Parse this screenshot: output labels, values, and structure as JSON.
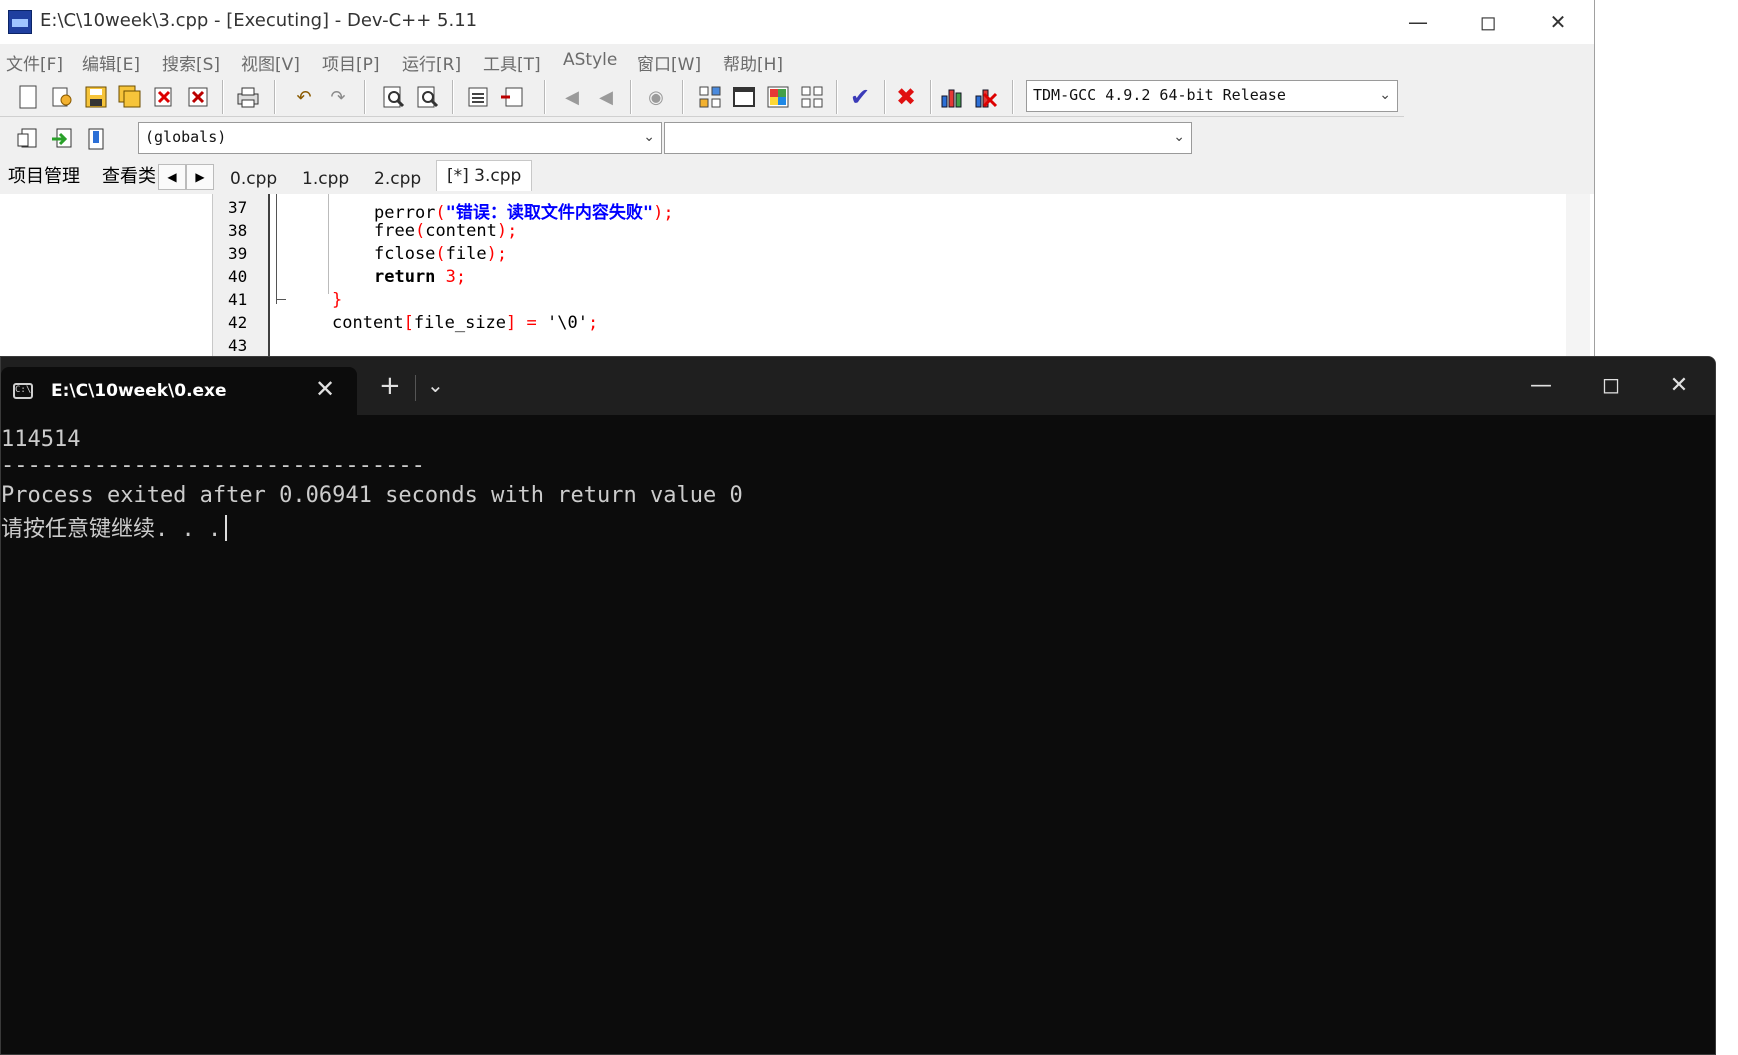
{
  "devcpp": {
    "title": "E:\\C\\10week\\3.cpp - [Executing] - Dev-C++ 5.11",
    "menu": [
      "文件[F]",
      "编辑[E]",
      "搜索[S]",
      "视图[V]",
      "项目[P]",
      "运行[R]",
      "工具[T]",
      "AStyle",
      "窗口[W]",
      "帮助[H]"
    ],
    "compiler_select": "TDM-GCC 4.9.2 64-bit Release",
    "scope_select": "(globals)",
    "left_tabs": [
      "项目管理",
      "查看类"
    ],
    "file_tabs": [
      "0.cpp",
      "1.cpp",
      "2.cpp",
      "[*] 3.cpp"
    ],
    "line_numbers": [
      "37",
      "38",
      "39",
      "40",
      "41",
      "42",
      "43"
    ],
    "code": {
      "l37_func": "perror",
      "l37_open": "(",
      "l37_str": "\"错误：读取文件内容失败\"",
      "l37_close": ");",
      "l38_a": "free",
      "l38_b": "(",
      "l38_c": "content",
      "l38_d": ");",
      "l39_a": "fclose",
      "l39_b": "(",
      "l39_c": "file",
      "l39_d": ");",
      "l40_kw": "return",
      "l40_num": "3",
      "l40_end": ";",
      "l41": "}",
      "l42_a": "content",
      "l42_b": "[",
      "l42_c": "file_size",
      "l42_d": "]",
      "l42_e": " = ",
      "l42_f": "'\\0'",
      "l42_g": ";"
    }
  },
  "terminal": {
    "tab_title": "E:\\C\\10week\\0.exe",
    "lines": [
      "114514",
      "--------------------------------",
      "Process exited after 0.06941 seconds with return value 0",
      "请按任意键继续. . ."
    ]
  },
  "icons": {
    "minimize": "minimize-icon",
    "maximize": "maximize-icon",
    "close": "close-icon"
  }
}
